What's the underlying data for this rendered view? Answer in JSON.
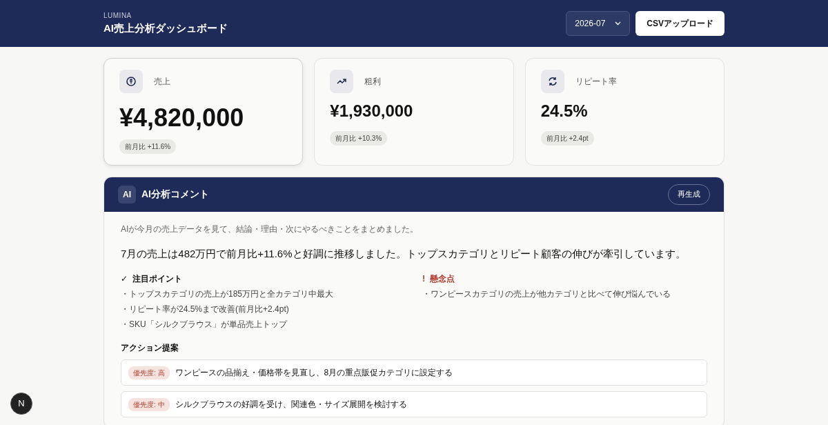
{
  "header": {
    "brand": "LUMINA",
    "title": "AI売上分析ダッシュボード",
    "month_select": {
      "value": "2026-07"
    },
    "upload_button": "CSVアップロード"
  },
  "kpis": [
    {
      "label": "売上",
      "value": "¥4,820,000",
      "change": "前月比 +11.6%",
      "selected": true
    },
    {
      "label": "粗利",
      "value": "¥1,930,000",
      "change": "前月比 +10.3%",
      "selected": false
    },
    {
      "label": "リピート率",
      "value": "24.5%",
      "change": "前月比 +2.4pt",
      "selected": false
    }
  ],
  "ai_panel": {
    "badge": "AI",
    "title": "AI分析コメント",
    "regenerate_button": "再生成",
    "intro": "AIが今月の売上データを見て、結論・理由・次にやるべきことをまとめました。",
    "summary": "7月の売上は482万円で前月比+11.6%と好調に推移しました。トップスカテゴリとリピート顧客の伸びが牽引しています。",
    "sections": [
      {
        "kind": "positive",
        "mark": "✓",
        "title": "注目ポイント",
        "items": [
          "・トップスカテゴリの売上が185万円と全カテゴリ中最大",
          "・リピート率が24.5%まで改善(前月比+2.4pt)",
          "・SKU「シルクブラウス」が単品売上トップ"
        ]
      },
      {
        "kind": "concern",
        "mark": "!",
        "title": "懸念点",
        "items": [
          "・ワンピースカテゴリの売上が他カテゴリと比べて伸び悩んでいる"
        ]
      }
    ],
    "actions_title": "アクション提案",
    "actions": [
      {
        "priority": "優先度: 高",
        "text": "ワンピースの品揃え・価格帯を見直し、8月の重点販促カテゴリに設定する"
      },
      {
        "priority": "優先度: 中",
        "text": "シルクブラウスの好調を受け、関連色・サイズ展開を検討する"
      }
    ]
  },
  "dev_badge": "N"
}
